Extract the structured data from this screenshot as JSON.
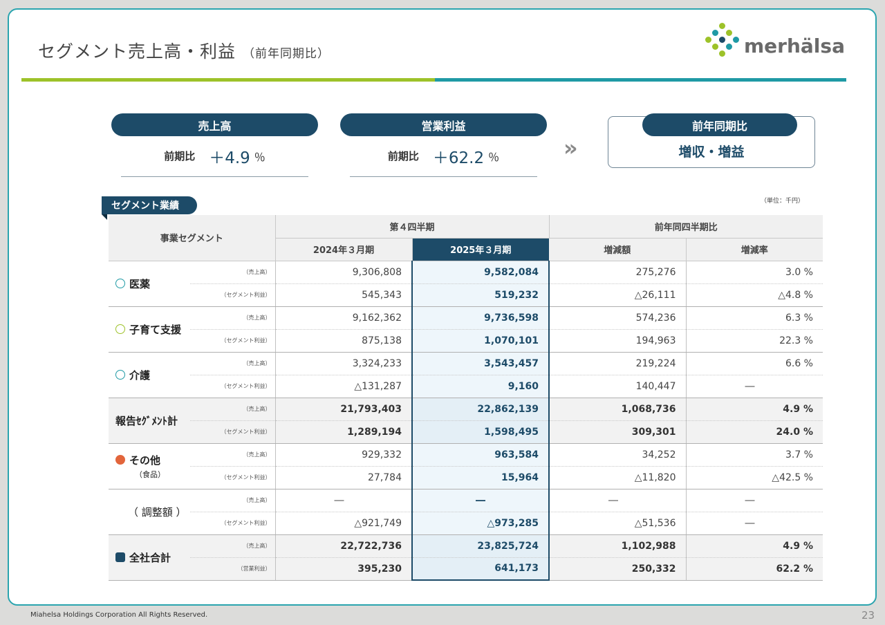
{
  "title": "セグメント売上高・利益",
  "subtitle": "（前年同期比）",
  "logo_text": "merhälsa",
  "kpis": [
    {
      "header": "売上高",
      "label": "前期比",
      "value": "＋4.9",
      "unit": "％"
    },
    {
      "header": "営業利益",
      "label": "前期比",
      "value": "＋62.2",
      "unit": "％"
    }
  ],
  "chevron": "»",
  "result": {
    "header": "前年同期比",
    "value": "増収・増益"
  },
  "segment_tag": "セグメント業績",
  "unit_note": "（単位：千円）",
  "table": {
    "col_segment": "事業セグメント",
    "group_q4": "第４四半期",
    "group_yoy": "前年同四半期比",
    "col_prev": "2024年３月期",
    "col_curr": "2025年３月期",
    "col_diff": "増減額",
    "col_rate": "増減率",
    "rows": [
      {
        "name": "医薬",
        "paren": "",
        "icon": "medicine-icon",
        "r1": {
          "label": "（売上高）",
          "prev": "9,306,808",
          "curr": "9,582,084",
          "diff": "275,276",
          "rate": "3.0 %"
        },
        "r2": {
          "label": "（セグメント利益）",
          "prev": "545,343",
          "curr": "519,232",
          "diff": "△26,111",
          "rate": "△4.8 %"
        }
      },
      {
        "name": "子育て支援",
        "paren": "",
        "icon": "childcare-icon",
        "r1": {
          "label": "（売上高）",
          "prev": "9,162,362",
          "curr": "9,736,598",
          "diff": "574,236",
          "rate": "6.3 %"
        },
        "r2": {
          "label": "（セグメント利益）",
          "prev": "875,138",
          "curr": "1,070,101",
          "diff": "194,963",
          "rate": "22.3 %"
        }
      },
      {
        "name": "介護",
        "paren": "",
        "icon": "nursing-care-icon",
        "r1": {
          "label": "（売上高）",
          "prev": "3,324,233",
          "curr": "3,543,457",
          "diff": "219,224",
          "rate": "6.6 %"
        },
        "r2": {
          "label": "（セグメント利益）",
          "prev": "△131,287",
          "curr": "9,160",
          "diff": "140,447",
          "rate": "―"
        }
      },
      {
        "name": "報告ｾｸﾞﾒﾝﾄ計",
        "paren": "",
        "icon": "",
        "r1": {
          "label": "（売上高）",
          "prev": "21,793,403",
          "curr": "22,862,139",
          "diff": "1,068,736",
          "rate": "4.9 %"
        },
        "r2": {
          "label": "（セグメント利益）",
          "prev": "1,289,194",
          "curr": "1,598,495",
          "diff": "309,301",
          "rate": "24.0 %"
        }
      },
      {
        "name": "その他",
        "paren": "（食品）",
        "icon": "food-icon",
        "r1": {
          "label": "（売上高）",
          "prev": "929,332",
          "curr": "963,584",
          "diff": "34,252",
          "rate": "3.7 %"
        },
        "r2": {
          "label": "（セグメント利益）",
          "prev": "27,784",
          "curr": "15,964",
          "diff": "△11,820",
          "rate": "△42.5 %"
        }
      },
      {
        "name": "（ 調整額 ）",
        "paren": "",
        "icon": "",
        "r1": {
          "label": "（売上高）",
          "prev": "―",
          "curr": "―",
          "diff": "―",
          "rate": "―"
        },
        "r2": {
          "label": "（セグメント利益）",
          "prev": "△921,749",
          "curr": "△973,285",
          "diff": "△51,536",
          "rate": "―"
        }
      },
      {
        "name": "全社合計",
        "paren": "",
        "icon": "company-total-icon",
        "r1": {
          "label": "（売上高）",
          "prev": "22,722,736",
          "curr": "23,825,724",
          "diff": "1,102,988",
          "rate": "4.9 %"
        },
        "r2": {
          "label": "（営業利益）",
          "prev": "395,230",
          "curr": "641,173",
          "diff": "250,332",
          "rate": "62.2 %"
        }
      }
    ]
  },
  "footer": "Miahelsa Holdings Corporation All Rights Reserved.",
  "page_number": "23",
  "colors": {
    "navy": "#1d4b68",
    "teal": "#1f9aa5",
    "green": "#9dc229",
    "highlight_bg": "#eef6fb"
  }
}
